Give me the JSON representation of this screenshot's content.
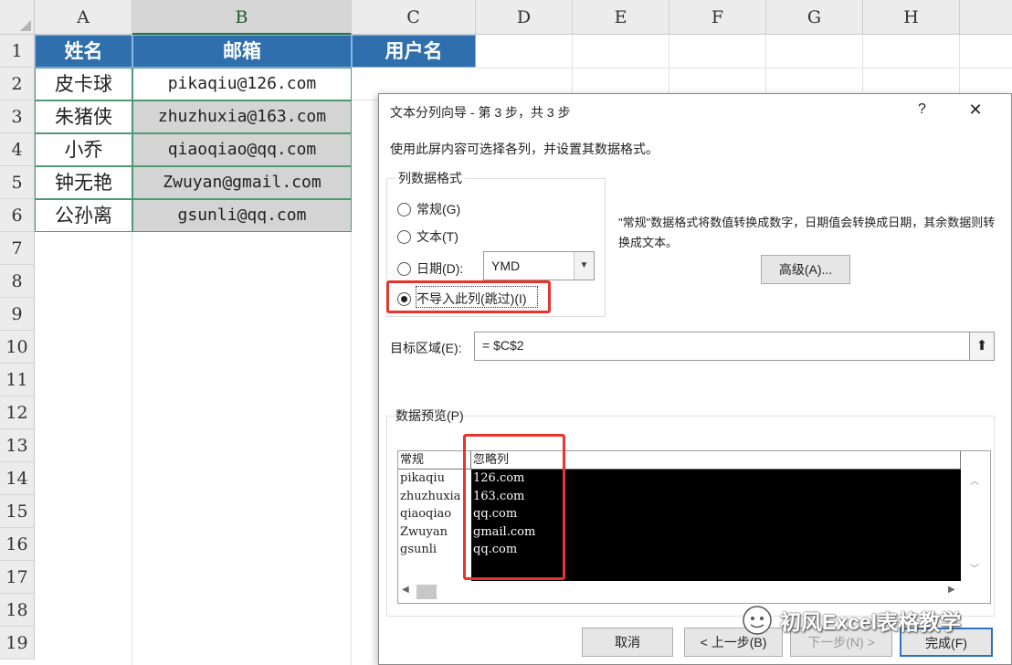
{
  "columns": [
    "A",
    "B",
    "C",
    "D",
    "E",
    "F",
    "G",
    "H"
  ],
  "rows": [
    "1",
    "2",
    "3",
    "4",
    "5",
    "6",
    "7",
    "8",
    "9",
    "10",
    "11",
    "12",
    "13",
    "14",
    "15",
    "16",
    "17",
    "18",
    "19"
  ],
  "table": {
    "headers": [
      "姓名",
      "邮箱",
      "用户名"
    ],
    "rows": [
      {
        "name": "皮卡球",
        "email": "pikaqiu@126.com"
      },
      {
        "name": "朱猪侠",
        "email": "zhuzhuxia@163.com"
      },
      {
        "name": "小乔",
        "email": "qiaoqiao@qq.com"
      },
      {
        "name": "钟无艳",
        "email": "Zwuyan@gmail.com"
      },
      {
        "name": "公孙离",
        "email": "gsunli@qq.com"
      }
    ]
  },
  "dialog": {
    "title": "文本分列向导 - 第 3 步，共 3 步",
    "help": "?",
    "close": "✕",
    "instruction": "使用此屏内容可选择各列，并设置其数据格式。",
    "format_group": "列数据格式",
    "options": [
      "常规(G)",
      "文本(T)",
      "日期(D):",
      "不导入此列(跳过)(I)"
    ],
    "date_format": "YMD",
    "description": "\"常规\"数据格式将数值转换成数字，日期值会转换成日期，其余数据则转换成文本。",
    "advanced": "高级(A)...",
    "dest_label": "目标区域(E):",
    "dest_value": "= $C$2",
    "preview_label": "数据预览(P)",
    "preview": {
      "col1_header": "常规",
      "col2_header": "忽略列",
      "col1": [
        "pikaqiu",
        "zhuzhuxia",
        "qiaoqiao",
        "Zwuyan",
        "gsunli"
      ],
      "col2": [
        "126.com",
        "163.com",
        "qq.com",
        "gmail.com",
        "qq.com"
      ]
    },
    "buttons": {
      "cancel": "取消",
      "back": "< 上一步(B)",
      "next": "下一步(N) >",
      "finish": "完成(F)"
    }
  },
  "watermark": "初风Excel表格教学",
  "colors": {
    "header_blue": "#2f6fad",
    "highlight_red": "#e8342c",
    "excel_green": "#217346"
  }
}
